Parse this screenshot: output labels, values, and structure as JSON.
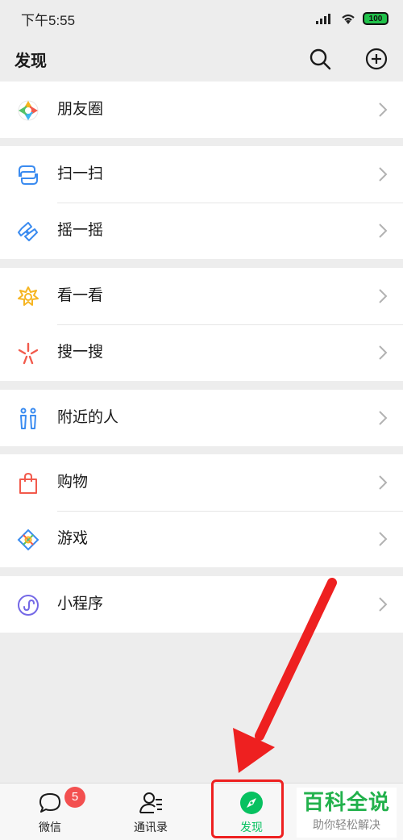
{
  "status_bar": {
    "time": "下午5:55",
    "battery": "100"
  },
  "nav": {
    "title": "发现",
    "search_icon": "search-icon",
    "add_icon": "plus-circle-icon"
  },
  "groups": [
    {
      "items": [
        {
          "label": "朋友圈",
          "icon": "moments-aperture-icon"
        }
      ]
    },
    {
      "items": [
        {
          "label": "扫一扫",
          "icon": "scan-icon"
        },
        {
          "label": "摇一摇",
          "icon": "shake-icon"
        }
      ]
    },
    {
      "items": [
        {
          "label": "看一看",
          "icon": "top-stories-icon"
        },
        {
          "label": "搜一搜",
          "icon": "search-sparkle-icon"
        }
      ]
    },
    {
      "items": [
        {
          "label": "附近的人",
          "icon": "people-nearby-icon"
        }
      ]
    },
    {
      "items": [
        {
          "label": "购物",
          "icon": "shopping-bag-icon"
        },
        {
          "label": "游戏",
          "icon": "games-icon"
        }
      ]
    },
    {
      "items": [
        {
          "label": "小程序",
          "icon": "mini-programs-icon"
        }
      ]
    }
  ],
  "tab_bar": {
    "tabs": [
      {
        "label": "微信",
        "icon": "chat-bubble-icon",
        "badge": "5"
      },
      {
        "label": "通讯录",
        "icon": "contacts-icon"
      },
      {
        "label": "发现",
        "icon": "compass-icon",
        "active": true
      }
    ]
  },
  "watermark": {
    "main": "百科全说",
    "sub": "助你轻松解决"
  },
  "colors": {
    "accent": "#07c160",
    "highlight": "#ee2020",
    "background": "#ededed"
  }
}
